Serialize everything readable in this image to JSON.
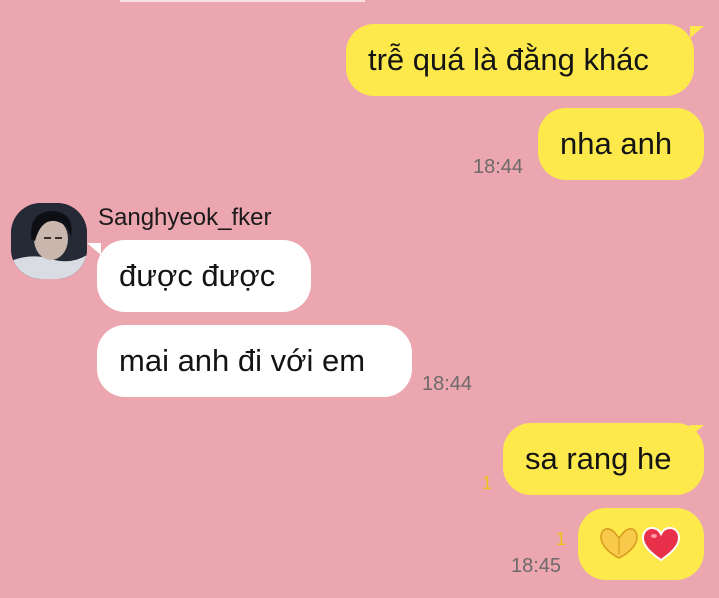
{
  "chat": {
    "sender_name": "Sanghyeok_fker",
    "messages": {
      "m1": "trễ quá là đằng khác",
      "m2": "nha anh",
      "m3": "được được",
      "m4": "mai anh đi với em",
      "m5": "sa rang he"
    },
    "times": {
      "t1": "18:44",
      "t2": "18:44",
      "t3": "18:45"
    },
    "unread": {
      "u1": "1",
      "u2": "1"
    },
    "sticker_icons": [
      "finger-heart-icon",
      "heart-icon"
    ]
  },
  "colors": {
    "background": "#eba6b0",
    "outgoing_bubble": "#fee94c",
    "incoming_bubble": "#ffffff",
    "unread_counter": "#f0c31a",
    "timestamp": "#6d6a6b"
  }
}
